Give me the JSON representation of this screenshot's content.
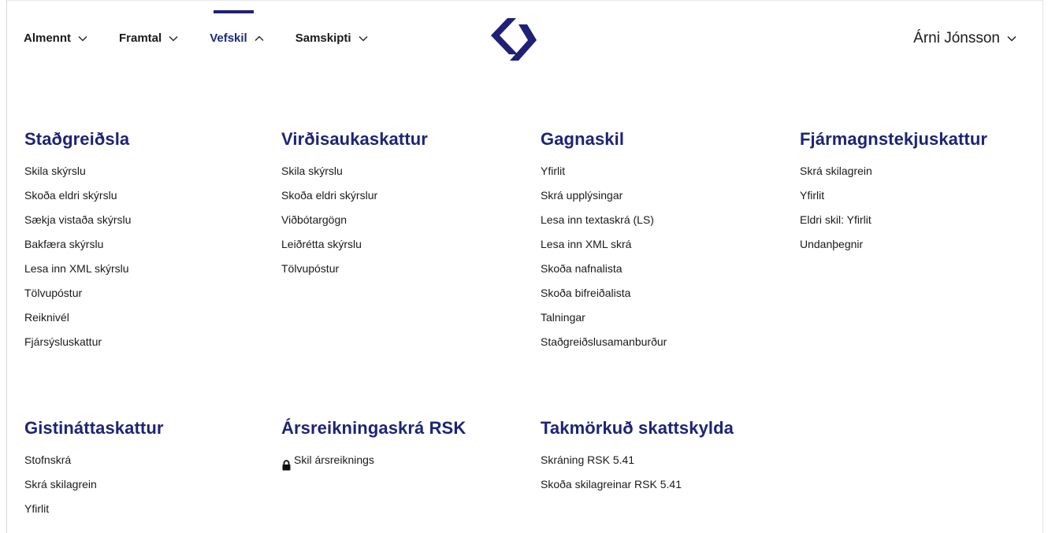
{
  "header": {
    "nav": [
      {
        "label": "Almennt",
        "active": false
      },
      {
        "label": "Framtal",
        "active": false
      },
      {
        "label": "Vefskil",
        "active": true
      },
      {
        "label": "Samskipti",
        "active": false
      }
    ],
    "user_name": "Árni Jónsson",
    "logo_icon": "rsk-logo-icon"
  },
  "colors": {
    "heading": "#1e2475",
    "accent": "#1e2175",
    "active_nav": "#1e2a78",
    "text": "#1a1a1a"
  },
  "sections": [
    {
      "title": "Staðgreiðsla",
      "links": [
        "Skila skýrslu",
        "Skoða eldri skýrslu",
        "Sækja vistaða skýrslu",
        "Bakfæra skýrslu",
        "Lesa inn XML skýrslu",
        "Tölvupóstur",
        "Reiknivél",
        "Fjársýsluskattur"
      ]
    },
    {
      "title": "Virðisaukaskattur",
      "links": [
        "Skila skýrslu",
        "Skoða eldri skýrslur",
        "Viðbótargögn",
        "Leiðrétta skýrslu",
        "Tölvupóstur"
      ]
    },
    {
      "title": "Gagnaskil",
      "links": [
        "Yfirlit",
        "Skrá upplýsingar",
        "Lesa inn textaskrá (LS)",
        "Lesa inn XML skrá",
        "Skoða nafnalista",
        "Skoða bifreiðalista",
        "Talningar",
        "Staðgreiðslusamanburður"
      ]
    },
    {
      "title": "Fjármagnstekjuskattur",
      "links": [
        "Skrá skilagrein",
        "Yfirlit",
        "Eldri skil: Yfirlit",
        "Undanþegnir"
      ]
    },
    {
      "title": "Gistináttaskattur",
      "links": [
        "Stofnskrá",
        "Skrá skilagrein",
        "Yfirlit"
      ]
    },
    {
      "title": "Ársreikningaskrá RSK",
      "links": [
        "Skil ársreiknings"
      ],
      "link_icons": [
        "lock-icon"
      ]
    },
    {
      "title": "Takmörkuð skattskylda",
      "links": [
        "Skráning RSK 5.41",
        "Skoða skilagreinar RSK 5.41"
      ]
    }
  ]
}
